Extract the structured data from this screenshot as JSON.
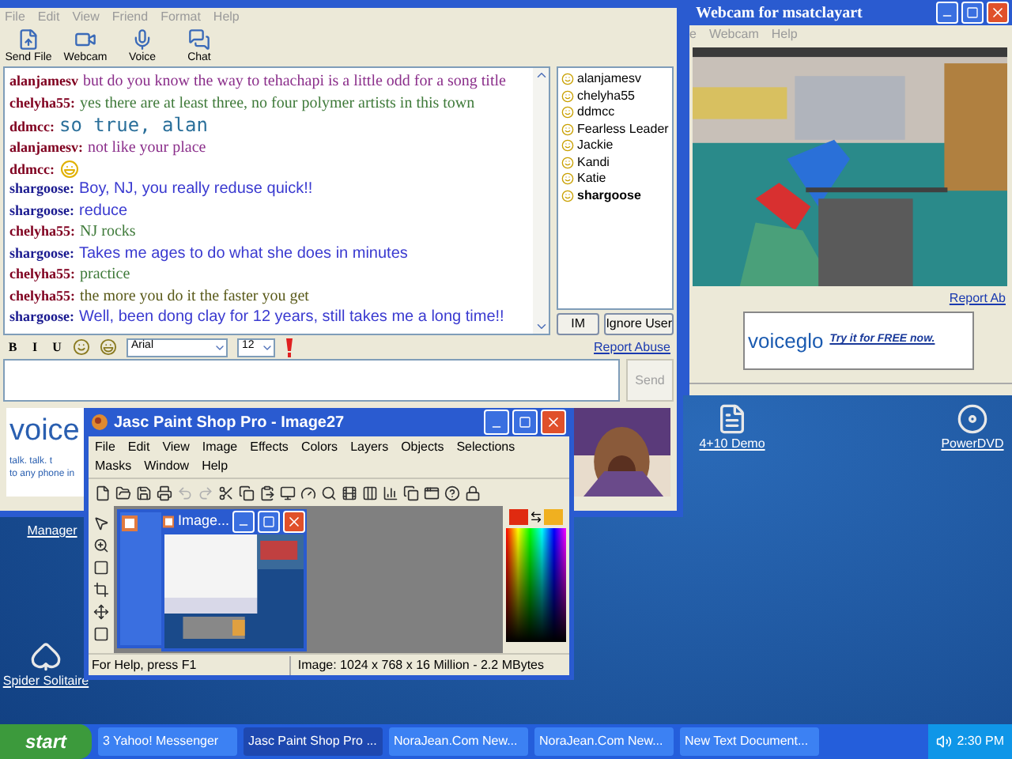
{
  "chat_window": {
    "menu": [
      "File",
      "Edit",
      "View",
      "Friend",
      "Format",
      "Help"
    ],
    "toolbar": [
      {
        "label": "Send File",
        "kind": "file"
      },
      {
        "label": "Webcam",
        "kind": "webcam"
      },
      {
        "label": "Voice",
        "kind": "voice"
      },
      {
        "label": "Chat",
        "kind": "chat"
      }
    ],
    "messages": [
      {
        "user": "alanjamesv",
        "text": "but do you know the way to tehachapi is a little odd for a song title",
        "kind": "serif",
        "color": "#8b2f8b"
      },
      {
        "user": "chelyha55:",
        "text": "yes there are at least three, no four polymer artists in this town",
        "kind": "serif",
        "color": "#3f7a3a"
      },
      {
        "user": "ddmcc:",
        "text": "so true, alan",
        "kind": "large",
        "color": "#2a6f9a"
      },
      {
        "user": "alanjamesv:",
        "text": "not like your place",
        "kind": "serif",
        "color": "#8b2f8b"
      },
      {
        "user": "ddmcc:",
        "kind": "emoticon",
        "color": "#e0b000"
      },
      {
        "user": "shargoose:",
        "text": "Boy, NJ, you really reduse quick!!",
        "kind": "sans",
        "color": "#3a3ad0"
      },
      {
        "user": "shargoose:",
        "text": "reduce",
        "kind": "sans",
        "color": "#3a3ad0"
      },
      {
        "user": "chelyha55:",
        "text": "NJ rocks",
        "kind": "serif",
        "color": "#3f7a3a"
      },
      {
        "user": "shargoose:",
        "text": "Takes me ages to do what she does in minutes",
        "kind": "sans",
        "color": "#3a3ad0"
      },
      {
        "user": "chelyha55:",
        "text": "practice",
        "kind": "serif",
        "color": "#3f7a3a"
      },
      {
        "user": "chelyha55:",
        "text": "the more you do it the faster you get",
        "kind": "serif",
        "color": "#5a5a1a"
      },
      {
        "user": "shargoose:",
        "text": "Well, been dong clay for 12 years, still takes me a long time!!",
        "kind": "sans",
        "color": "#3a3ad0"
      }
    ],
    "users": [
      {
        "name": "alanjamesv",
        "bold": false
      },
      {
        "name": "chelyha55",
        "bold": false
      },
      {
        "name": "ddmcc",
        "bold": false
      },
      {
        "name": "Fearless Leader",
        "bold": false
      },
      {
        "name": "Jackie",
        "bold": false
      },
      {
        "name": "Kandi",
        "bold": false
      },
      {
        "name": "Katie",
        "bold": false
      },
      {
        "name": "shargoose",
        "bold": true
      }
    ],
    "buttons": [
      "IM",
      "Ignore User"
    ],
    "format": {
      "styles": [
        "B",
        "I",
        "U"
      ],
      "font": "Arial",
      "size": "12"
    },
    "report_link": "Report Abuse",
    "send_button": "Send",
    "ad": {
      "brand": "voice",
      "lines": [
        "talk. talk. t",
        "to any phone in"
      ]
    }
  },
  "webcam_window": {
    "title": "Webcam for msatclayart",
    "menu": [
      "e",
      "Webcam",
      "Help"
    ],
    "report_link": "Report Ab",
    "ad": {
      "brand": "voiceglo",
      "cta": "Try it for FREE now."
    }
  },
  "paint_window": {
    "title": "Jasc Paint Shop Pro - Image27",
    "menu": [
      "File",
      "Edit",
      "View",
      "Image",
      "Effects",
      "Colors",
      "Layers",
      "Objects",
      "Selections",
      "Masks",
      "Window",
      "Help"
    ],
    "document_title": "Image...",
    "status_left": "For Help, press F1",
    "status_right": "Image:  1024 x 768 x 16 Million - 2.2 MBytes"
  },
  "desktop_icons": [
    {
      "label": "Manager",
      "kind": "app"
    },
    {
      "label": "Spider Solitaire",
      "kind": "cards"
    },
    {
      "label": "4+10 Demo",
      "kind": "document"
    },
    {
      "label": "PowerDVD",
      "kind": "disc"
    }
  ],
  "taskbar": {
    "start": "start",
    "buttons": [
      {
        "label": "3 Yahoo! Messenger",
        "selected": false
      },
      {
        "label": "Jasc Paint Shop Pro ...",
        "selected": true
      },
      {
        "label": "NoraJean.Com New...",
        "selected": false
      },
      {
        "label": "NoraJean.Com New...",
        "selected": false
      },
      {
        "label": "New Text Document...",
        "selected": false
      }
    ],
    "clock": "2:30 PM"
  }
}
